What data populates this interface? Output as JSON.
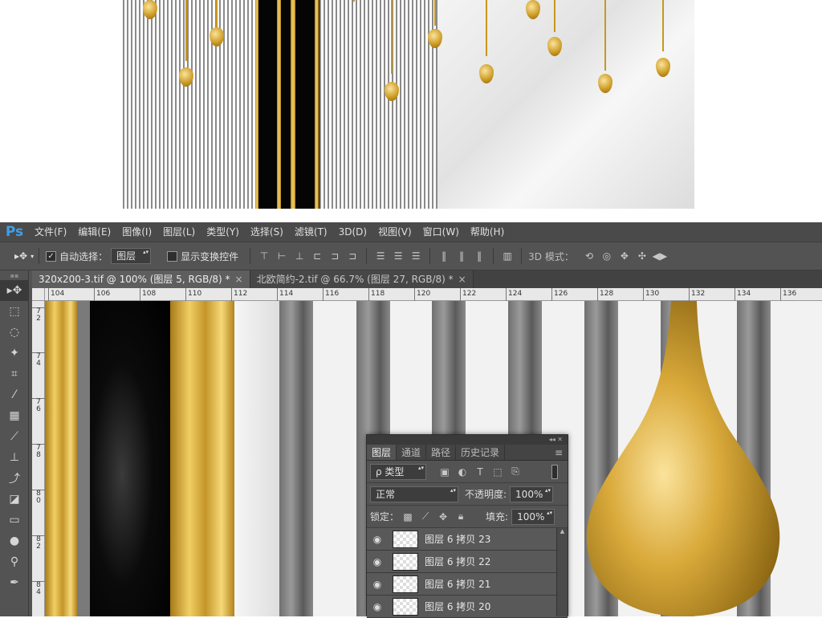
{
  "menu": {
    "logo": "Ps",
    "items": [
      "文件(F)",
      "编辑(E)",
      "图像(I)",
      "图层(L)",
      "类型(Y)",
      "选择(S)",
      "滤镜(T)",
      "3D(D)",
      "视图(V)",
      "窗口(W)",
      "帮助(H)"
    ]
  },
  "options": {
    "move_arrow": "▸✥",
    "auto_select_label": "自动选择：",
    "auto_select_checked": true,
    "auto_select_target": "图层",
    "show_transform_label": "显示变换控件",
    "mode_3d_label": "3D 模式："
  },
  "tabs": [
    {
      "label": "320x200-3.tif @ 100% (图层 5, RGB/8) *",
      "close": "×"
    },
    {
      "label": "北欧简约-2.tif @ 66.7% (图层 27, RGB/8) *",
      "close": "×"
    }
  ],
  "ruler_h": [
    "104",
    "106",
    "108",
    "110",
    "112",
    "114",
    "116",
    "118",
    "120",
    "122",
    "124",
    "126",
    "128",
    "130",
    "132",
    "134",
    "136"
  ],
  "ruler_v": [
    "7\n2",
    "7\n4",
    "7\n6",
    "7\n8",
    "8\n0",
    "8\n2",
    "8\n4"
  ],
  "layers_panel": {
    "tabs": [
      "图层",
      "通道",
      "路径",
      "历史记录"
    ],
    "filter_label": "ρ 类型",
    "blend_mode": "正常",
    "opacity_label": "不透明度:",
    "opacity_value": "100%",
    "lock_label": "锁定：",
    "fill_label": "填充:",
    "fill_value": "100%",
    "layers": [
      "图层 6 拷贝 23",
      "图层 6 拷贝 22",
      "图层 6 拷贝 21",
      "图层 6 拷贝 20"
    ]
  }
}
